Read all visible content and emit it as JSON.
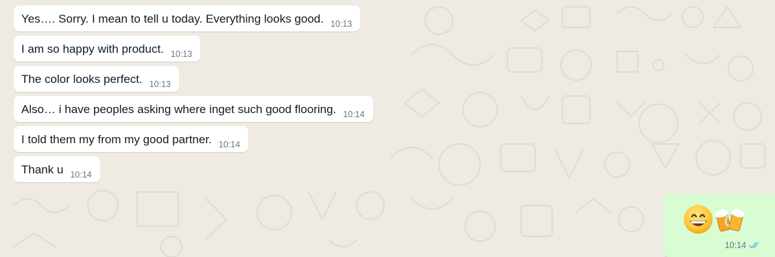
{
  "messages_in": [
    {
      "text": "Yes…. Sorry.  I mean to tell u today.  Everything looks good.",
      "time": "10:13"
    },
    {
      "text": "I am so happy with product.",
      "time": "10:13"
    },
    {
      "text": "The color looks perfect.",
      "time": "10:13"
    },
    {
      "text": "Also… i have peoples asking where inget such good flooring.",
      "time": "10:14"
    },
    {
      "text": "I told them my from my good partner.",
      "time": "10:14"
    },
    {
      "text": "Thank u",
      "time": "10:14"
    }
  ],
  "message_out": {
    "emojis": [
      "grinning-face-emoji",
      "clinking-beer-mugs-emoji"
    ],
    "time": "10:14",
    "status": "read-double-check-icon"
  },
  "colors": {
    "chat_background": "#efeae2",
    "incoming_bubble": "#ffffff",
    "outgoing_bubble": "#d9fdd3",
    "read_ticks": "#53bdeb",
    "timestamp": "#667781"
  }
}
